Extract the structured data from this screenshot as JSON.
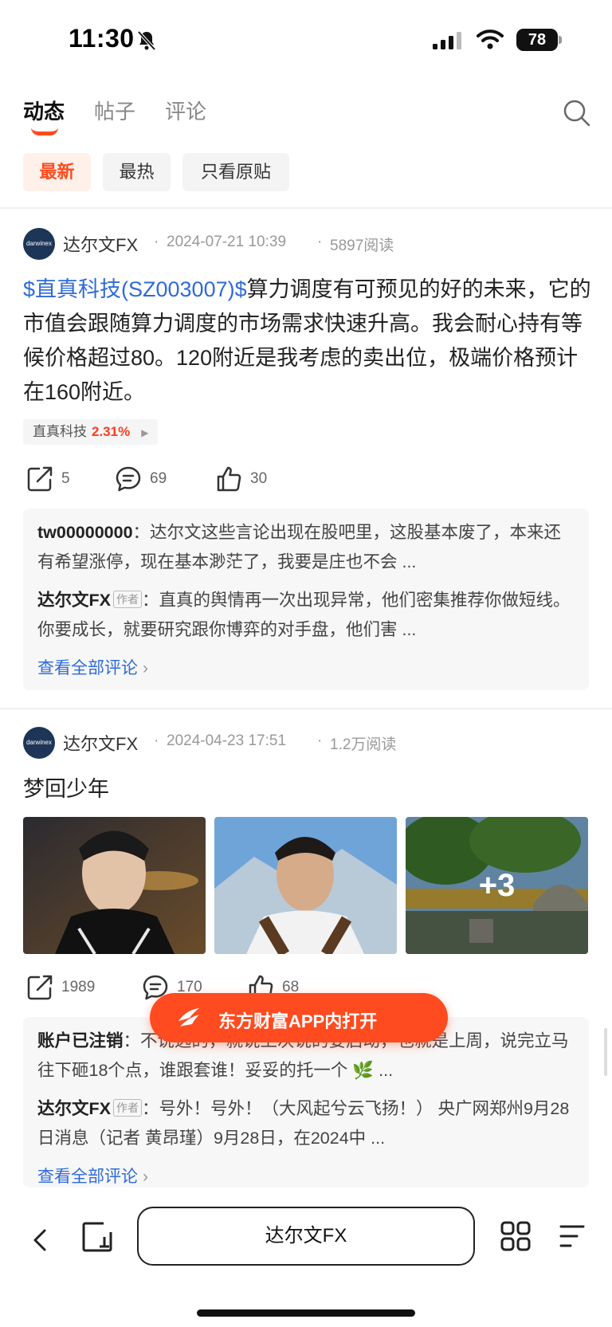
{
  "status_bar": {
    "time": "11:30",
    "battery": "78"
  },
  "tabs": [
    {
      "label": "动态"
    },
    {
      "label": "帖子"
    },
    {
      "label": "评论"
    }
  ],
  "filters": [
    {
      "label": "最新"
    },
    {
      "label": "最热"
    },
    {
      "label": "只看原贴"
    }
  ],
  "posts": [
    {
      "author": "达尔文FX",
      "avatar_text": "darwinex",
      "date": "2024-07-21 10:39",
      "reads": "5897阅读",
      "stock_link": "$直真科技(SZ003007)$",
      "body": "算力调度有可预见的好的未来，它的市值会跟随算力调度的市场需求快速升高。我会耐心持有等候价格超过80。120附近是我考虑的卖出位，极端价格预计在160附近。",
      "stock_tag": {
        "name": "直真科技",
        "change": "2.31%"
      },
      "shares": "5",
      "comments_count": "69",
      "likes": "30",
      "comments": [
        {
          "user": "tw00000000",
          "is_author": false,
          "text": "：达尔文这些言论出现在股吧里，这股基本废了，本来还有希望涨停，现在基本渺茫了，我要是庄也不会 ..."
        },
        {
          "user": "达尔文FX",
          "is_author": true,
          "badge": "作者",
          "text": "：直真的舆情再一次出现异常，他们密集推荐你做短线。你要成长，就要研究跟你博弈的对手盘，他们害 ..."
        }
      ],
      "see_all": "查看全部评论"
    },
    {
      "author": "达尔文FX",
      "avatar_text": "darwinex",
      "date": "2024-04-23 17:51",
      "reads": "1.2万阅读",
      "title": "梦回少年",
      "more_images": "+3",
      "shares": "1989",
      "comments_count": "170",
      "likes": "68",
      "comments": [
        {
          "user": "账户已注销",
          "is_author": false,
          "text": "：不说远的，就说上次说的要启动，也就是上周，说完立马往下砸18个点，谁跟套谁！妥妥的托一个 🌿 ..."
        },
        {
          "user": "达尔文FX",
          "is_author": true,
          "badge": "作者",
          "text": "：号外！号外！（大风起兮云飞扬！） 央广网郑州9月28日消息（记者 黄昂瑾）9月28日，在2024中 ..."
        }
      ],
      "see_all": "查看全部评论"
    }
  ],
  "open_app": "东方财富APP内打开",
  "address_bar": "达尔文FX",
  "colors": {
    "accent": "#ff4b1f",
    "link": "#2f6ad9"
  }
}
